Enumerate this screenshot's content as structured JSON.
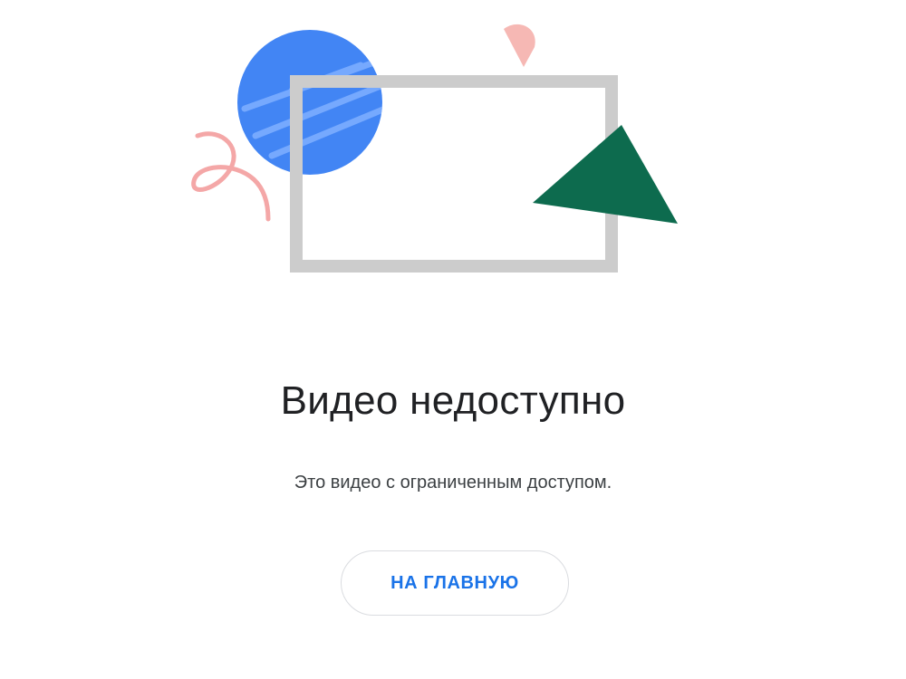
{
  "error": {
    "title": "Видео недоступно",
    "message": "Это видео с ограниченным доступом.",
    "home_button_label": "НА ГЛАВНУЮ"
  },
  "illustration": {
    "icons": [
      "blue-circle-icon",
      "pink-swirl-icon",
      "pink-semicircle-icon",
      "video-frame-icon",
      "green-triangle-icon"
    ],
    "colors": {
      "blue_circle": "#4285f4",
      "blue_stripes": "#7fb0ff",
      "pink": "#f4a7a7",
      "frame_gray": "#cccccc",
      "green_triangle": "#0d6b4e"
    }
  },
  "colors": {
    "accent": "#1a73e8",
    "title_text": "#202124",
    "body_text": "#3c4043",
    "button_border": "#dadce0"
  }
}
